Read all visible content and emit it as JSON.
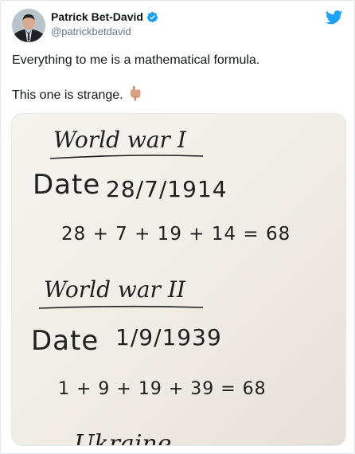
{
  "tweet": {
    "author": {
      "display_name": "Patrick Bet-David",
      "handle": "@patrickbetdavid",
      "verified": true,
      "avatar_icon": "profile-photo"
    },
    "brand_icon": "twitter-bird-icon",
    "brand_color": "#1da1f2",
    "text_lines": [
      "Everything to me is a mathematical formula.",
      "This one is strange."
    ],
    "emoji": "point-down-emoji",
    "media": {
      "blocks": [
        {
          "title": "World war I",
          "date_label": "Date",
          "date_value": "28/7/1914",
          "formula": "28 + 7 + 19 + 14 = 68"
        },
        {
          "title": "World war II",
          "date_label": "Date",
          "date_value": "1/9/1939",
          "formula": "1 + 9 + 19 + 39 = 68"
        }
      ],
      "partial_text": "... Ukraine"
    }
  }
}
